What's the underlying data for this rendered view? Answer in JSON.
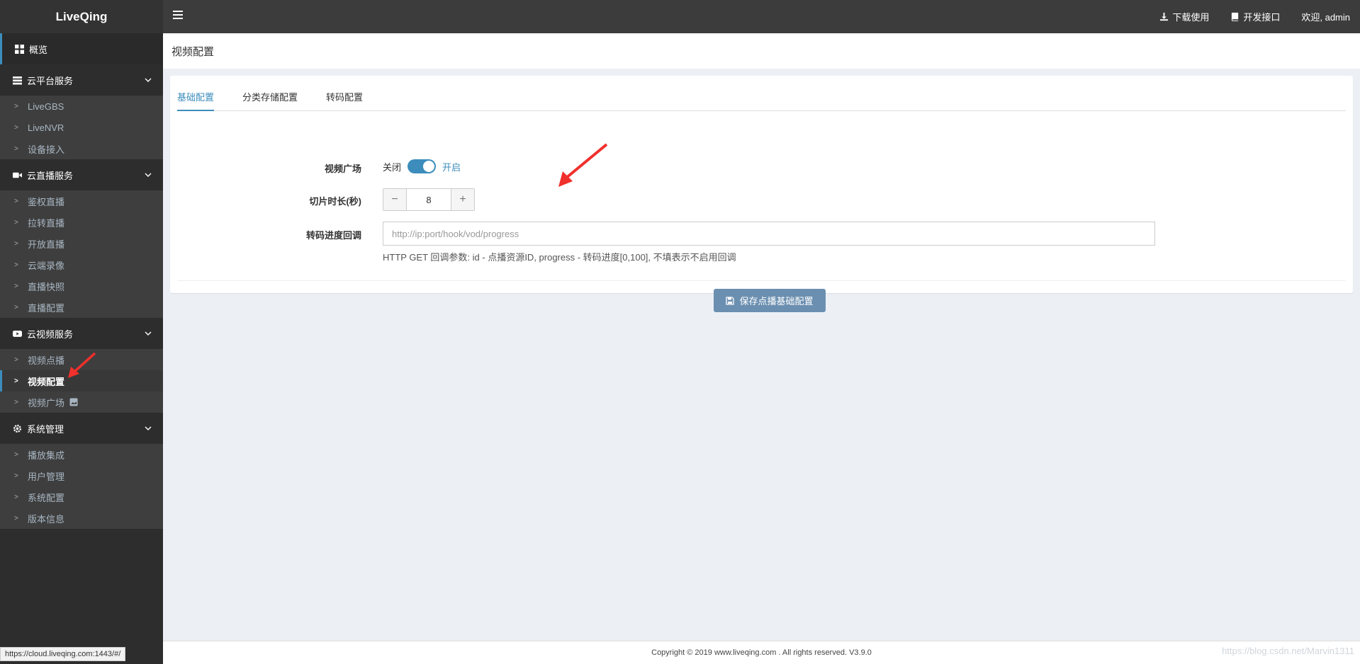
{
  "app": {
    "logo": "LiveQing"
  },
  "topbar": {
    "download": "下载使用",
    "api": "开发接口",
    "welcome": "欢迎, admin"
  },
  "sidebar": {
    "overview": "概览",
    "groups": [
      {
        "label": "云平台服务",
        "items": [
          "LiveGBS",
          "LiveNVR",
          "设备接入"
        ]
      },
      {
        "label": "云直播服务",
        "items": [
          "鉴权直播",
          "拉转直播",
          "开放直播",
          "云端录像",
          "直播快照",
          "直播配置"
        ]
      },
      {
        "label": "云视频服务",
        "items": [
          "视频点播",
          "视频配置",
          "视频广场"
        ]
      },
      {
        "label": "系统管理",
        "items": [
          "播放集成",
          "用户管理",
          "系统配置",
          "版本信息"
        ]
      }
    ]
  },
  "page": {
    "title": "视频配置"
  },
  "tabs": [
    "基础配置",
    "分类存储配置",
    "转码配置"
  ],
  "form": {
    "square_label": "视频广场",
    "off_label": "关闭",
    "on_label": "开启",
    "slice_label": "切片时长(秒)",
    "slice_value": "8",
    "minus": "−",
    "plus": "+",
    "callback_label": "转码进度回调",
    "callback_placeholder": "http://ip:port/hook/vod/progress",
    "callback_help": "HTTP GET 回调参数: id - 点播资源ID, progress - 转码进度[0,100], 不填表示不启用回调",
    "save_label": "保存点播基础配置"
  },
  "footer": {
    "copyright": "Copyright © 2019 www.liveqing.com . All rights reserved. V3.9.0",
    "watermark": "https://blog.csdn.net/Marvin1311"
  },
  "statusbar": {
    "url": "https://cloud.liveqing.com:1443/#/"
  },
  "colors": {
    "accent": "#3c8dbc",
    "annotation": "#f0302c"
  }
}
